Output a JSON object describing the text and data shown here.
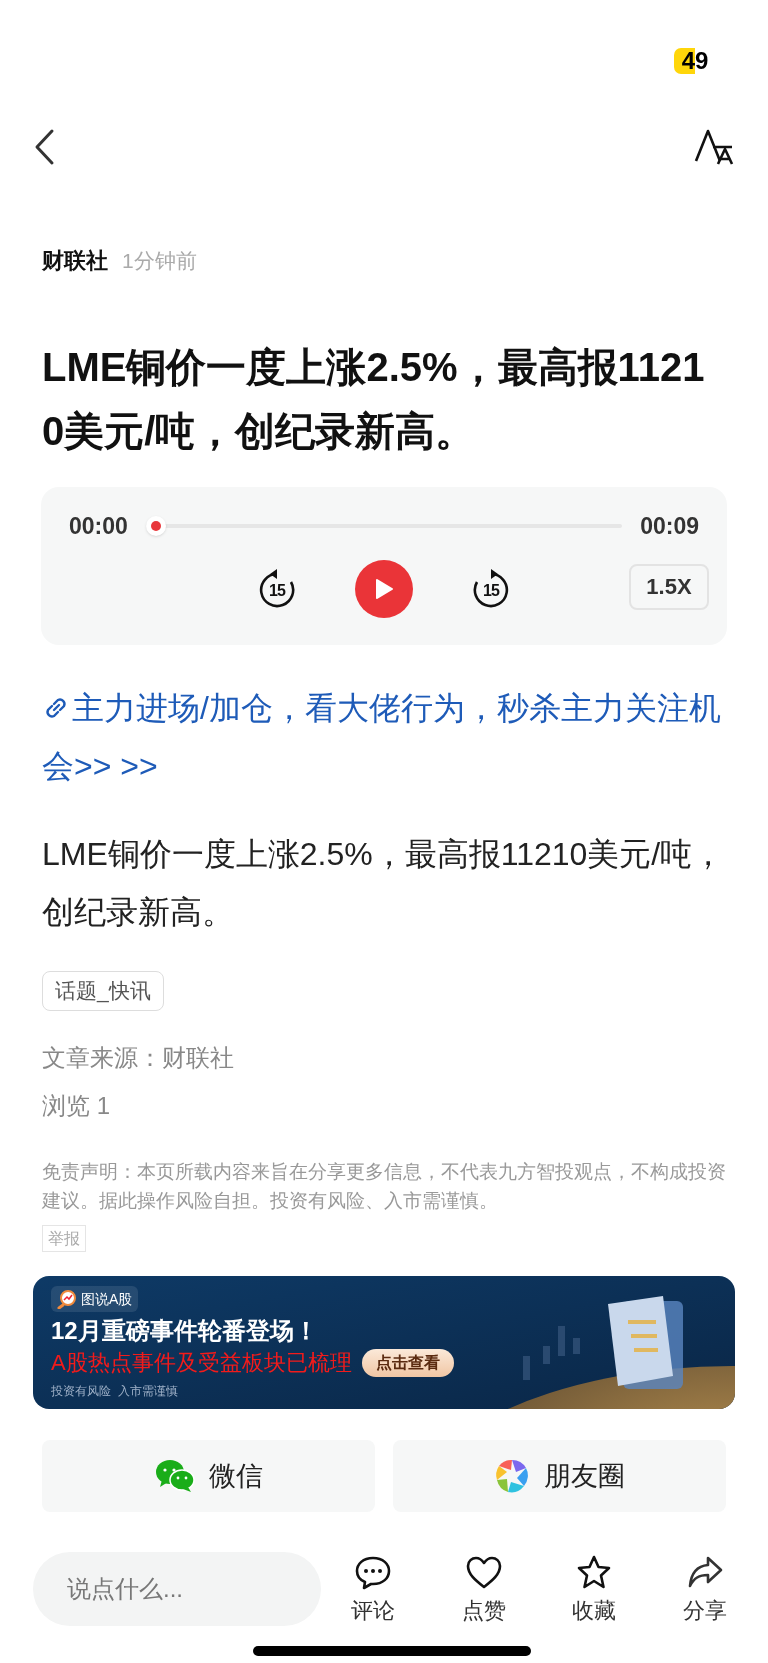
{
  "status_bar": {
    "battery_text": "49",
    "low_power": true
  },
  "article": {
    "source": "财联社",
    "time": "1分钟前",
    "title": "LME铜价一度上涨2.5%，最高报11210美元/吨，创纪录新高。"
  },
  "player": {
    "elapsed": "00:00",
    "duration": "00:09",
    "back_label": "15",
    "forward_label": "15",
    "speed": "1.5X"
  },
  "promo_link": "主力进场/加仓，看大佬行为，秒杀主力关注机会>> >>",
  "body": "LME铜价一度上涨2.5%，最高报11210美元/吨，创纪录新高。",
  "tags": [
    "话题_快讯"
  ],
  "meta": [
    "文章来源：财联社",
    "浏览 1"
  ],
  "disclaimer": "免责声明：本页所载内容来旨在分享更多信息，不代表九方智投观点，不构成投资建议。据此操作风险自担。投资有风险、入市需谨慎。",
  "report": "举报",
  "banner": {
    "kind": "picture",
    "badge": "图说A股",
    "headline": "12月重磅事件轮番登场！",
    "subline": "A股热点事件及受益板块已梳理",
    "cta": "点击查看",
    "note": "投资有风险  入市需谨慎"
  },
  "share": [
    {
      "kind": "wechat",
      "label": "微信"
    },
    {
      "kind": "moments",
      "label": "朋友圈"
    }
  ],
  "bottom_bar": {
    "placeholder": "说点什么...",
    "actions": [
      {
        "kind": "comment",
        "label": "评论"
      },
      {
        "kind": "like",
        "label": "点赞"
      },
      {
        "kind": "favorite",
        "label": "收藏"
      },
      {
        "kind": "share",
        "label": "分享"
      }
    ]
  }
}
